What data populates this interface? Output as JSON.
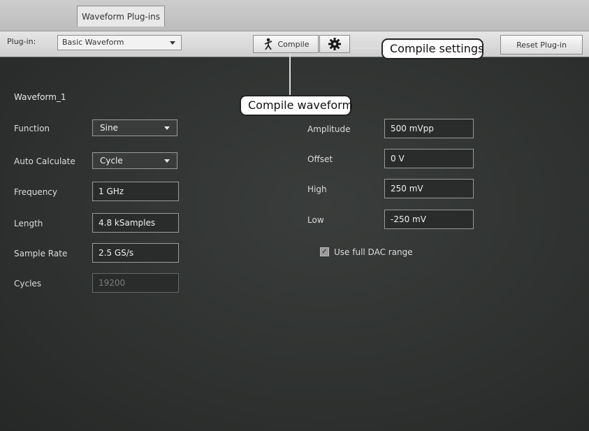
{
  "tab": {
    "label": "Waveform Plug-ins"
  },
  "toolbar": {
    "plugin_label": "Plug-in:",
    "plugin_value": "Basic Waveform",
    "compile_label": "Compile",
    "reset_label": "Reset Plug-in"
  },
  "callouts": {
    "settings": "Compile settings",
    "compile": "Compile waveform"
  },
  "waveform_name": "Waveform_1",
  "left": {
    "function_label": "Function",
    "function_value": "Sine",
    "auto_calc_label": "Auto Calculate",
    "auto_calc_value": "Cycle",
    "frequency_label": "Frequency",
    "frequency_value": "1 GHz",
    "length_label": "Length",
    "length_value": "4.8 kSamples",
    "sample_rate_label": "Sample Rate",
    "sample_rate_value": "2.5 GS/s",
    "cycles_label": "Cycles",
    "cycles_value": "19200"
  },
  "right": {
    "amplitude_label": "Amplitude",
    "amplitude_value": "500 mVpp",
    "offset_label": "Offset",
    "offset_value": "0 V",
    "high_label": "High",
    "high_value": "250 mV",
    "low_label": "Low",
    "low_value": "-250 mV",
    "dac_label": "Use full DAC range",
    "dac_checked": true
  },
  "icons": {
    "compile": "compile-person-icon",
    "settings": "gear-icon"
  }
}
